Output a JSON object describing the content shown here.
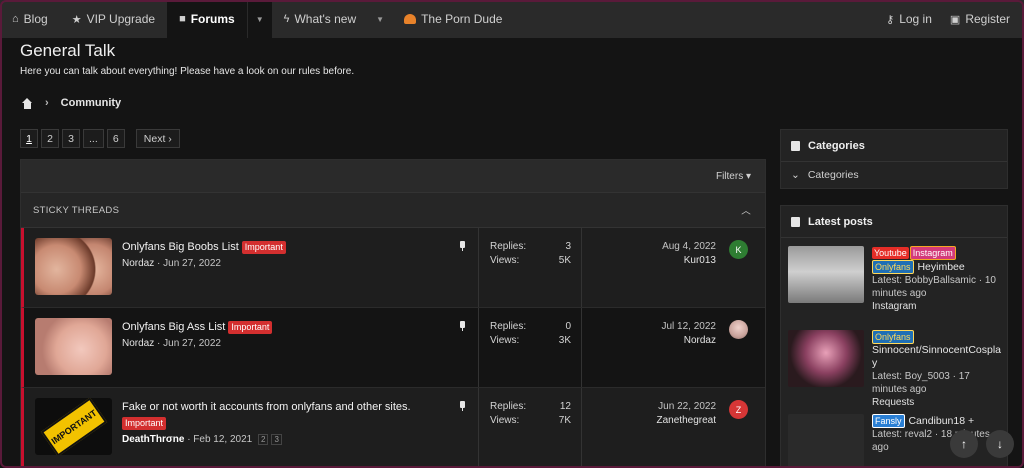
{
  "nav": {
    "items": [
      {
        "label": "Blog",
        "icon": "home-icon"
      },
      {
        "label": "VIP Upgrade",
        "icon": "star-icon"
      },
      {
        "label": "Forums",
        "icon": "comment-icon"
      },
      {
        "label": "What's new",
        "icon": "bolt-icon"
      },
      {
        "label": "The Porn Dude",
        "icon": "dude-icon"
      }
    ],
    "login": "Log in",
    "register": "Register"
  },
  "header": {
    "title": "General Talk",
    "description": "Here you can talk about everything! Please have a look on our rules before."
  },
  "breadcrumb": {
    "label": "Community"
  },
  "pager": {
    "pages": [
      "1",
      "2",
      "3",
      "...",
      "6"
    ],
    "next": "Next ›"
  },
  "list": {
    "filters": "Filters ▾",
    "sticky_header": "STICKY THREADS",
    "threads": [
      {
        "title": "Onlyfans Big Boobs List",
        "badge": "Important",
        "author": "Nordaz",
        "date": "Jun 27, 2022",
        "replies_label": "Replies:",
        "replies": "3",
        "views_label": "Views:",
        "views": "5K",
        "last_date": "Aug 4, 2022",
        "last_user": "Kur013",
        "avatar_letter": "K"
      },
      {
        "title": "Onlyfans Big Ass List",
        "badge": "Important",
        "author": "Nordaz",
        "date": "Jun 27, 2022",
        "replies_label": "Replies:",
        "replies": "0",
        "views_label": "Views:",
        "views": "3K",
        "last_date": "Jul 12, 2022",
        "last_user": "Nordaz",
        "avatar_letter": ""
      },
      {
        "title": "Fake or not worth it accounts from onlyfans and other sites.",
        "badge": "Important",
        "author": "DeathThrσne",
        "date": "Feb 12, 2021",
        "mini_pages": [
          "2",
          "3"
        ],
        "thumb_text": "IMPORTANT",
        "replies_label": "Replies:",
        "replies": "12",
        "views_label": "Views:",
        "views": "7K",
        "last_date": "Jun 22, 2022",
        "last_user": "Zanethegreat",
        "avatar_letter": "Z"
      }
    ]
  },
  "sidebar": {
    "categories_title": "Categories",
    "categories_item": "Categories",
    "latest_title": "Latest posts",
    "posts": [
      {
        "tags": [
          "Youtube",
          "Instagram",
          "Onlyfans"
        ],
        "title": "Heyimbee",
        "latest": "Latest: BobbyBallsamic · 10 minutes ago",
        "forum": "Instagram"
      },
      {
        "tags": [
          "Onlyfans"
        ],
        "title": "Sinnocent/SinnocentCosplay",
        "latest": "Latest: Boy_5003 · 17 minutes ago",
        "forum": "Requests"
      },
      {
        "tags": [
          "Fansly"
        ],
        "title": "Candibun18 +",
        "latest": "Latest: reval2 · 18 minutes ago",
        "forum": ""
      }
    ]
  },
  "fab": {
    "up": "↑",
    "down": "↓"
  }
}
